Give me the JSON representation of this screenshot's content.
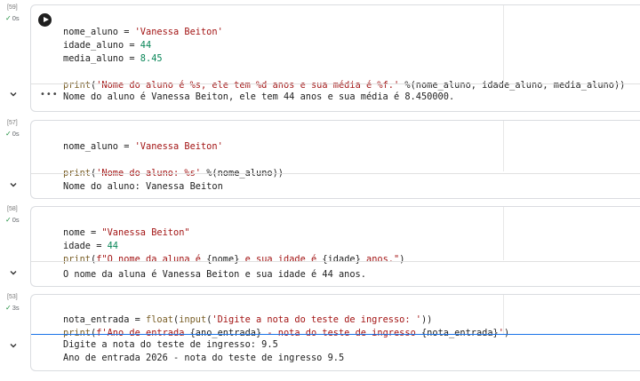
{
  "cells": [
    {
      "exec_count": "[59]",
      "exec_time": "0s",
      "code": [
        "nome_aluno = 'Vanessa Beiton'",
        "idade_aluno = 44",
        "media_aluno = 8.45",
        "",
        "print('Nome do aluno é %s, ele tem %d anos e sua média é %f.' %(nome_aluno, idade_aluno, media_aluno))"
      ],
      "output": [
        "Nome do aluno é Vanessa Beiton, ele tem 44 anos e sua média é 8.450000."
      ]
    },
    {
      "exec_count": "[57]",
      "exec_time": "0s",
      "code": [
        "nome_aluno = 'Vanessa Beiton'",
        "",
        "print('Nome do aluno: %s' %(nome_aluno))"
      ],
      "output": [
        "Nome do aluno: Vanessa Beiton"
      ]
    },
    {
      "exec_count": "[58]",
      "exec_time": "0s",
      "code": [
        "nome = \"Vanessa Beiton\"",
        "idade = 44",
        "print(f\"O nome da aluna é {nome} e sua idade é {idade} anos.\")"
      ],
      "output": [
        "O nome da aluna é Vanessa Beiton e sua idade é 44 anos."
      ]
    },
    {
      "exec_count": "[53]",
      "exec_time": "3s",
      "code": [
        "nota_entrada = float(input('Digite a nota do teste de ingresso: '))",
        "print(f'Ano de entrada {ano_entrada} - nota do teste de ingresso {nota_entrada}')"
      ],
      "output": [
        "Digite a nota do teste de ingresso: 9.5",
        "Ano de entrada 2026 - nota do teste de ingresso 9.5"
      ]
    }
  ],
  "icons": {
    "run": "play-icon",
    "collapse": "chevron-down-icon",
    "more": "more-horizontal-icon",
    "done": "check-icon"
  },
  "colors": {
    "string": "#a31515",
    "number": "#098658",
    "focus": "#1a73e8",
    "success": "#1e8e3e"
  }
}
